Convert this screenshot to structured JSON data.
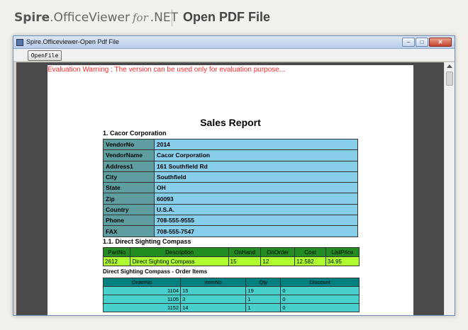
{
  "banner": {
    "brand_bold": "Spire",
    "brand_rest": ".OfficeViewer",
    "brand_for": "for",
    "brand_net": ".NET",
    "title": "Open PDF File"
  },
  "window": {
    "title": "Spire.Officeviewer-Open Pdf File",
    "minimize": "–",
    "maximize": "□",
    "close": "✕"
  },
  "toolbar": {
    "open_label": "OpenFile"
  },
  "document": {
    "warning": "Evaluation Warning : The version can be used only for evaluation purpose...",
    "report_title": "Sales Report",
    "section1": "1. Cacor Corporation",
    "vendor": [
      {
        "k": "VendorNo",
        "v": "2014"
      },
      {
        "k": "VendorName",
        "v": "Cacor Corporation"
      },
      {
        "k": "Address1",
        "v": "161 Southfield Rd"
      },
      {
        "k": "City",
        "v": "Southfield"
      },
      {
        "k": "State",
        "v": "OH"
      },
      {
        "k": "Zip",
        "v": "60093"
      },
      {
        "k": "Country",
        "v": "U.S.A."
      },
      {
        "k": "Phone",
        "v": "708-555-9555"
      },
      {
        "k": "FAX",
        "v": "708-555-7547"
      }
    ],
    "section11": "1.1. Direct Sighting Compass",
    "parts_headers": [
      "PartNo",
      "Description",
      "OnHand",
      "OnOrder",
      "Cost",
      "ListPrice"
    ],
    "parts_row": [
      "2612",
      "Direct Sighting Compass",
      "15",
      "12",
      "12.582",
      "34.95"
    ],
    "orders_title": "Direct Sighting Compass - Order Items",
    "orders_headers": [
      "OrderNo",
      "ItemNo",
      "Qty",
      "Discount"
    ],
    "orders_rows": [
      [
        "1104",
        "15",
        "19",
        "0"
      ],
      [
        "1105",
        "3",
        "1",
        "0"
      ],
      [
        "1152",
        "14",
        "1",
        "0"
      ]
    ]
  }
}
